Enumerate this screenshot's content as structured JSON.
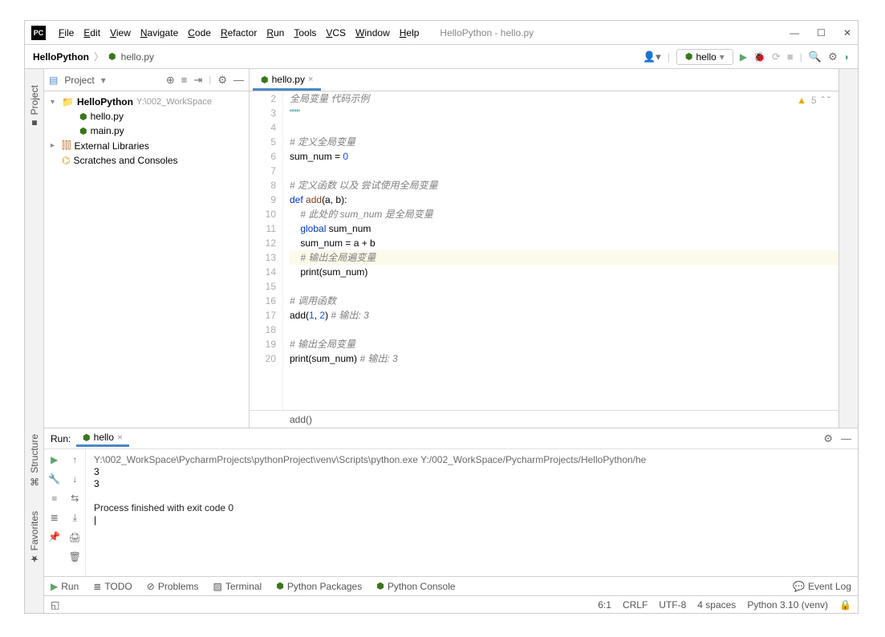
{
  "window": {
    "title": "HelloPython - hello.py"
  },
  "menu": [
    "File",
    "Edit",
    "View",
    "Navigate",
    "Code",
    "Refactor",
    "Run",
    "Tools",
    "VCS",
    "Window",
    "Help"
  ],
  "breadcrumb": {
    "project": "HelloPython",
    "file": "hello.py"
  },
  "runConfig": {
    "name": "hello"
  },
  "projectPanel": {
    "title": "Project",
    "root": {
      "name": "HelloPython",
      "path": "Y:\\002_WorkSpace"
    },
    "files": [
      "hello.py",
      "main.py"
    ],
    "extLib": "External Libraries",
    "scratches": "Scratches and Consoles"
  },
  "editorTab": {
    "file": "hello.py"
  },
  "inspection": {
    "count": "5"
  },
  "code": {
    "lines": [
      {
        "n": 2,
        "tokens": [
          [
            "cmt",
            "全局变量 代码示例"
          ]
        ]
      },
      {
        "n": 3,
        "tokens": [
          [
            "str",
            "\"\"\""
          ]
        ]
      },
      {
        "n": 4,
        "tokens": [
          [
            "",
            ""
          ]
        ]
      },
      {
        "n": 5,
        "tokens": [
          [
            "cmt",
            "# 定义全局变量"
          ]
        ]
      },
      {
        "n": 6,
        "tokens": [
          [
            "",
            "sum_num = "
          ],
          [
            "num",
            "0"
          ]
        ]
      },
      {
        "n": 7,
        "tokens": [
          [
            "",
            ""
          ]
        ]
      },
      {
        "n": 8,
        "tokens": [
          [
            "cmt",
            "# 定义函数 以及 尝试使用全局变量"
          ]
        ]
      },
      {
        "n": 9,
        "tokens": [
          [
            "kw",
            "def"
          ],
          [
            "",
            " "
          ],
          [
            "fn",
            "add"
          ],
          [
            "",
            "(a, b):"
          ]
        ]
      },
      {
        "n": 10,
        "tokens": [
          [
            "",
            "    "
          ],
          [
            "cmt",
            "# 此处的 sum_num 是全局变量"
          ]
        ]
      },
      {
        "n": 11,
        "tokens": [
          [
            "",
            "    "
          ],
          [
            "kw",
            "global"
          ],
          [
            "",
            " sum_num"
          ]
        ]
      },
      {
        "n": 12,
        "tokens": [
          [
            "",
            "    sum_num = a + b"
          ]
        ]
      },
      {
        "n": 13,
        "hl": true,
        "tokens": [
          [
            "",
            "    "
          ],
          [
            "cmt",
            "# 输出全局遍变量"
          ]
        ]
      },
      {
        "n": 14,
        "tokens": [
          [
            "",
            "    "
          ],
          [
            "bi",
            "print"
          ],
          [
            "",
            "(sum_num)"
          ]
        ]
      },
      {
        "n": 15,
        "tokens": [
          [
            "",
            ""
          ]
        ]
      },
      {
        "n": 16,
        "tokens": [
          [
            "cmt",
            "# 调用函数"
          ]
        ]
      },
      {
        "n": 17,
        "tokens": [
          [
            "",
            "add("
          ],
          [
            "num",
            "1"
          ],
          [
            "",
            ", "
          ],
          [
            "num",
            "2"
          ],
          [
            "",
            ") "
          ],
          [
            "cmt",
            "# 输出: 3"
          ]
        ]
      },
      {
        "n": 18,
        "tokens": [
          [
            "",
            ""
          ]
        ]
      },
      {
        "n": 19,
        "tokens": [
          [
            "cmt",
            "# 输出全局变量"
          ]
        ]
      },
      {
        "n": 20,
        "tokens": [
          [
            "bi",
            "print"
          ],
          [
            "",
            "(sum_num) "
          ],
          [
            "cmt",
            "# 输出: 3"
          ]
        ]
      }
    ],
    "breadcrumb": "add()"
  },
  "runPanel": {
    "label": "Run:",
    "tab": "hello",
    "output": {
      "path": "Y:\\002_WorkSpace\\PycharmProjects\\pythonProject\\venv\\Scripts\\python.exe Y:/002_WorkSpace/PycharmProjects/HelloPython/he",
      "lines": [
        "3",
        "3"
      ],
      "exit": "Process finished with exit code 0"
    }
  },
  "toolWindows": {
    "run": "Run",
    "todo": "TODO",
    "problems": "Problems",
    "terminal": "Terminal",
    "pkgs": "Python Packages",
    "console": "Python Console",
    "eventlog": "Event Log"
  },
  "status": {
    "pos": "6:1",
    "lineend": "CRLF",
    "encoding": "UTF-8",
    "indent": "4 spaces",
    "interp": "Python 3.10 (venv)"
  },
  "leftTabs": {
    "project": "Project",
    "structure": "Structure",
    "favorites": "Favorites"
  }
}
